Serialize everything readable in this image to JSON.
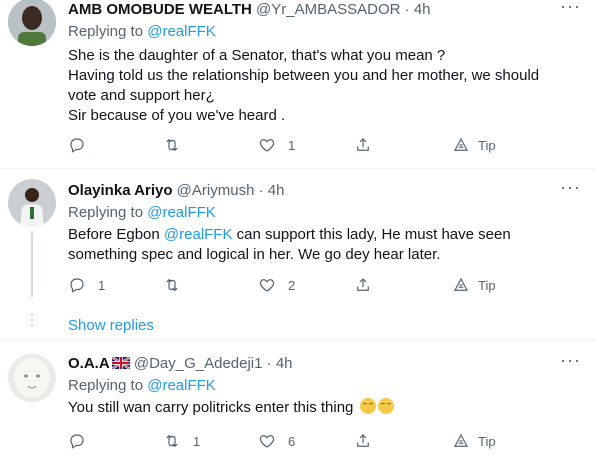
{
  "tweets": [
    {
      "name": "AMB OMOBUDE WEALTH",
      "handle": "@Yr_AMBASSADOR",
      "sep": "·",
      "time": "4h",
      "replying_prefix": "Replying to",
      "replying_to": "@realFFK",
      "lines": [
        "She is the daughter of a Senator, that's what you mean ?",
        "Having told us the relationship between you and her mother, we should vote and support her¿",
        "Sir because of you we've heard ."
      ],
      "reply_count": "",
      "retweet_count": "",
      "like_count": "1",
      "tip_label": "Tip"
    },
    {
      "name": "Olayinka Ariyo",
      "handle": "@Ariymush",
      "sep": "·",
      "time": "4h",
      "replying_prefix": "Replying to",
      "replying_to": "@realFFK",
      "body_before": "Before Egbon ",
      "body_mention": "@realFFK",
      "body_after": " can support this lady, He must have seen something spec and logical in her. We go dey hear later.",
      "reply_count": "1",
      "retweet_count": "",
      "like_count": "2",
      "tip_label": "Tip"
    },
    {
      "name": "O.A.A",
      "flag": "uk-flag",
      "handle": "@Day_G_Adedeji1",
      "sep": "·",
      "time": "4h",
      "replying_prefix": "Replying to",
      "replying_to": "@realFFK",
      "body": "You still wan carry politricks enter this thing",
      "emojis": [
        "relieved-face",
        "relieved-face"
      ],
      "reply_count": "",
      "retweet_count": "1",
      "like_count": "6",
      "tip_label": "Tip"
    }
  ],
  "show_replies": "Show replies",
  "colors": {
    "accent": "#1d9bf0",
    "muted": "#536471",
    "text": "#0f1419",
    "divider": "#eff3f4"
  },
  "icons": [
    "more-icon",
    "reply-icon",
    "retweet-icon",
    "like-icon",
    "share-icon",
    "tip-icon"
  ]
}
